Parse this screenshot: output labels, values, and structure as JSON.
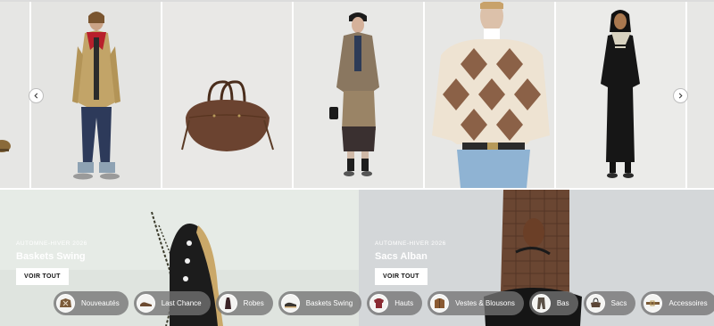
{
  "banners": [
    {
      "kicker": "AUTOMNE-HIVER 2026",
      "title": "Baskets Swing",
      "cta": "VOIR TOUT"
    },
    {
      "kicker": "AUTOMNE-HIVER 2026",
      "title": "Sacs Alban",
      "cta": "VOIR TOUT"
    }
  ],
  "categories": [
    {
      "label": "Nouveautés"
    },
    {
      "label": "Last Chance"
    },
    {
      "label": "Robes"
    },
    {
      "label": "Baskets Swing"
    },
    {
      "label": "Hauts"
    },
    {
      "label": "Vestes & Blousons"
    },
    {
      "label": "Bas"
    },
    {
      "label": "Sacs"
    },
    {
      "label": "Accessoires"
    }
  ],
  "carousel": {
    "products": [
      {
        "icon": "shoe-product-image"
      },
      {
        "icon": "camel-coat-look-image"
      },
      {
        "icon": "brown-bag-product-image"
      },
      {
        "icon": "tweed-set-look-image"
      },
      {
        "icon": "argyle-sweater-look-image"
      },
      {
        "icon": "black-dress-look-image"
      },
      {
        "icon": "partial-product-image"
      }
    ]
  }
}
